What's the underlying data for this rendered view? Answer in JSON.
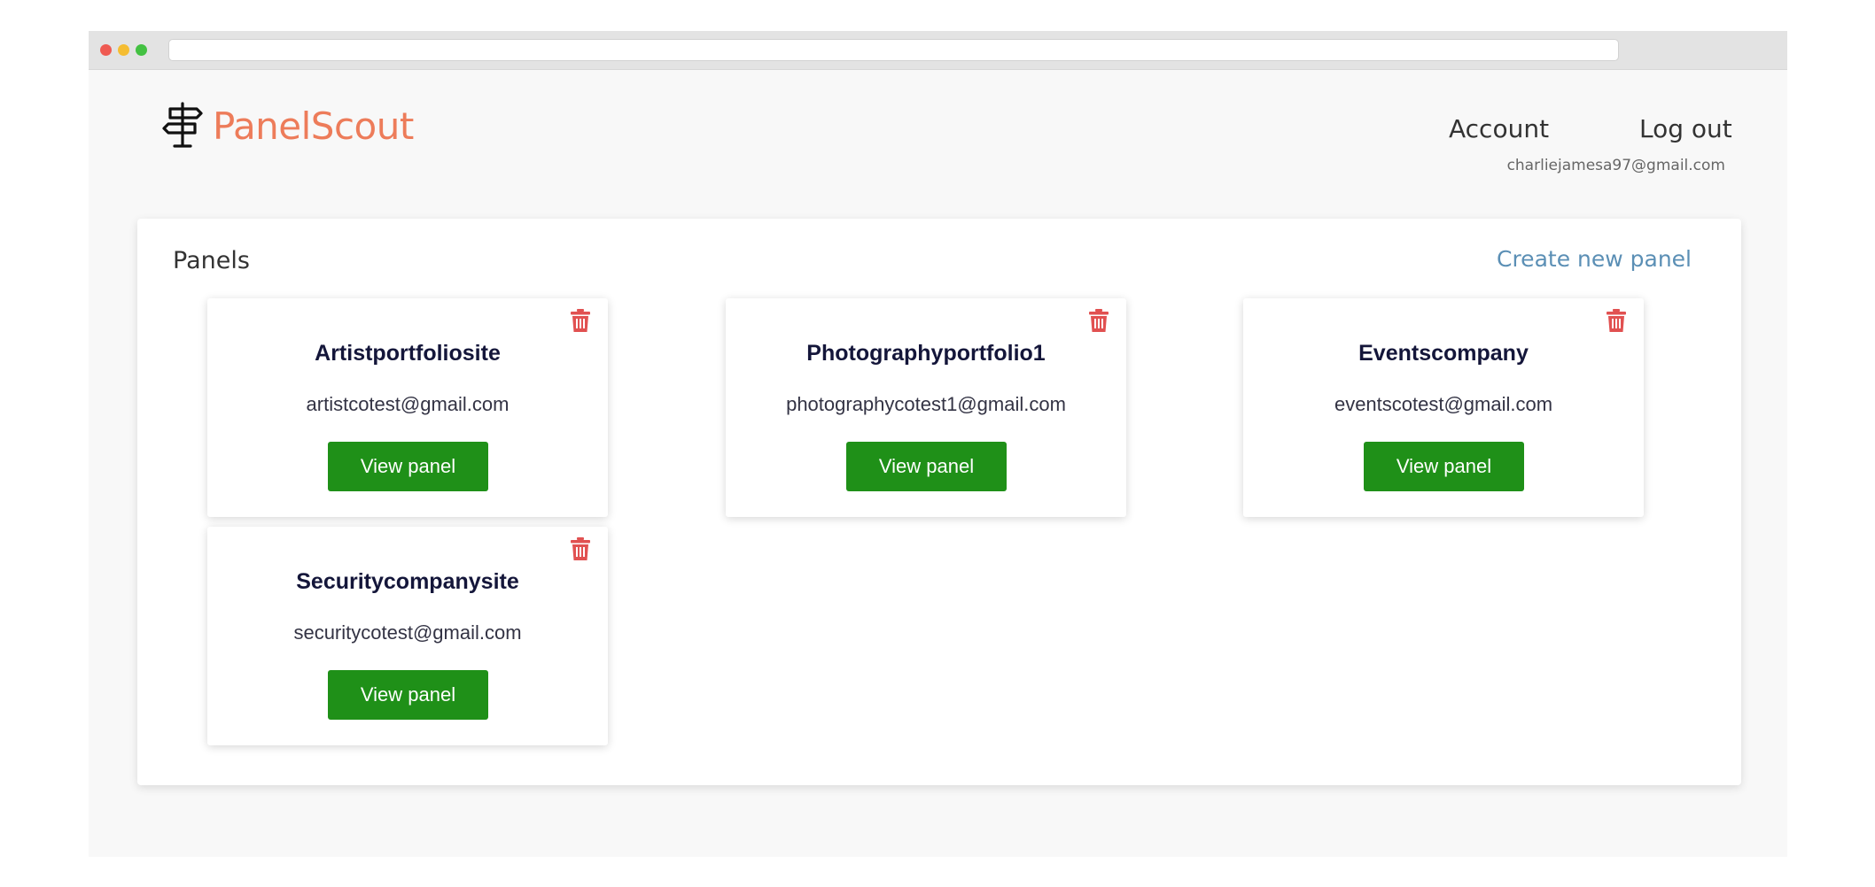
{
  "brand": {
    "name": "PanelScout",
    "icon": "signpost-icon"
  },
  "nav": {
    "account": "Account",
    "logout": "Log out",
    "user_email": "charliejamesa97@gmail.com"
  },
  "main": {
    "title": "Panels",
    "create_link": "Create new panel"
  },
  "panels": [
    {
      "name": "Artistportfoliosite",
      "email": "artistcotest@gmail.com",
      "button": "View panel"
    },
    {
      "name": "Photographyportfolio1",
      "email": "photographycotest1@gmail.com",
      "button": "View panel"
    },
    {
      "name": "Eventscompany",
      "email": "eventscotest@gmail.com",
      "button": "View panel"
    },
    {
      "name": "Securitycompanysite",
      "email": "securitycotest@gmail.com",
      "button": "View panel"
    }
  ],
  "colors": {
    "brand_accent": "#ed7c5a",
    "button_green": "#1f9018",
    "delete_red": "#e15151",
    "link_blue": "#5b8fb5"
  }
}
